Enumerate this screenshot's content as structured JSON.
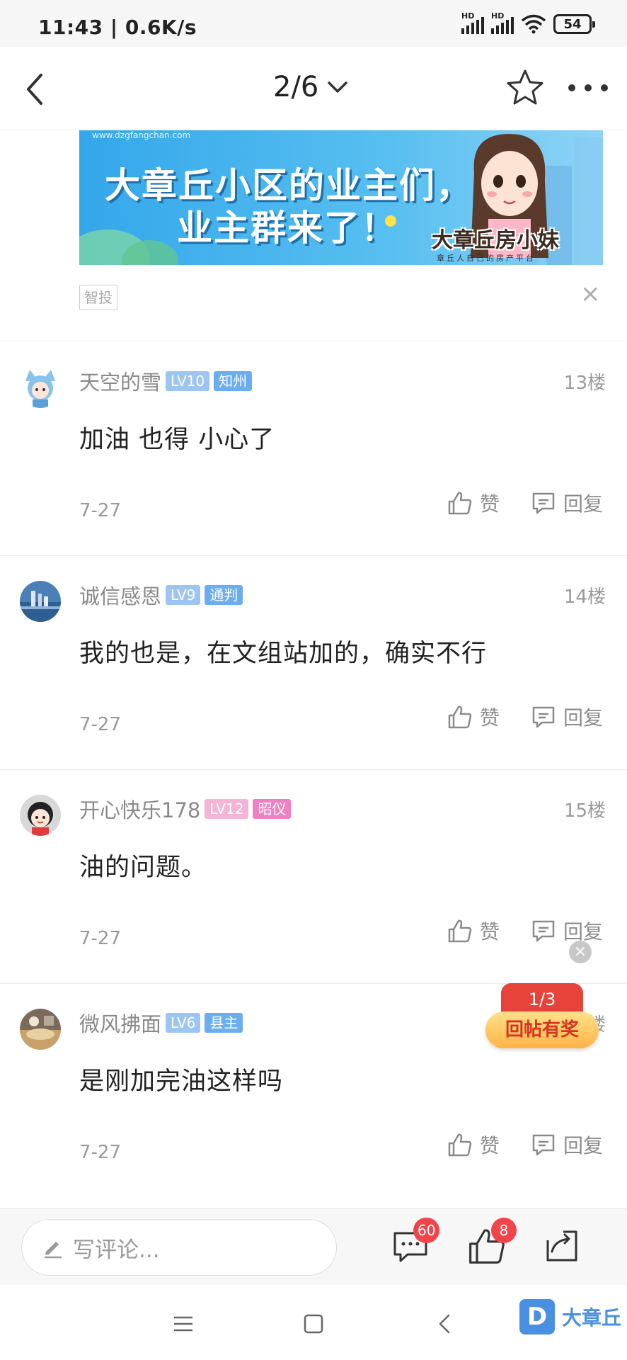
{
  "status_bar": {
    "time": "11:43 | 0.6K/s",
    "battery": "54",
    "signal_label": "HD"
  },
  "header": {
    "page_indicator": "2/6"
  },
  "ad": {
    "logo_sub": "www.dzgfangchan.com",
    "title_line1": "大章丘小区的业主们，",
    "title_line2": "业主群来了！",
    "brand": "大章丘房小妹",
    "brand_sub": "章丘人自己的房产平台",
    "tag": "智投",
    "close": "×"
  },
  "comments": [
    {
      "username": "天空的雪",
      "level": "LV10",
      "title": "知州",
      "floor": "13楼",
      "content": "加油 也得 小心了",
      "date": "7-27",
      "like_label": "赞",
      "reply_label": "回复",
      "level_color": "#9ec5f2",
      "title_color": "#6aaef0"
    },
    {
      "username": "诚信感恩",
      "level": "LV9",
      "title": "通判",
      "floor": "14楼",
      "content": "我的也是，在文组站加的，确实不行",
      "date": "7-27",
      "like_label": "赞",
      "reply_label": "回复",
      "level_color": "#9ec5f2",
      "title_color": "#6aaef0"
    },
    {
      "username": "开心快乐178",
      "level": "LV12",
      "title": "昭仪",
      "floor": "15楼",
      "content": "油的问题。",
      "date": "7-27",
      "like_label": "赞",
      "reply_label": "回复",
      "level_color": "#f5b3d6",
      "title_color": "#f081c3"
    },
    {
      "username": "微风拂面",
      "level": "LV6",
      "title": "县主",
      "floor": "16楼",
      "content": "是刚加完油这样吗",
      "date": "7-27",
      "like_label": "赞",
      "reply_label": "回复",
      "level_color": "#9ec5f2",
      "title_color": "#6aaef0"
    }
  ],
  "promo": {
    "counter": "1/3",
    "label": "回帖有奖",
    "close": "×"
  },
  "bottom_bar": {
    "input_placeholder": "写评论...",
    "comment_count": "60",
    "like_count": "8"
  },
  "watermark": {
    "logo": "D",
    "text": "大章丘"
  },
  "icons": [
    "back-icon",
    "chevron-down-icon",
    "star-icon",
    "more-icon",
    "thumbs-up-icon",
    "reply-icon",
    "pencil-icon",
    "comment-icon",
    "share-icon",
    "menu-icon",
    "home-icon",
    "back-nav-icon"
  ]
}
